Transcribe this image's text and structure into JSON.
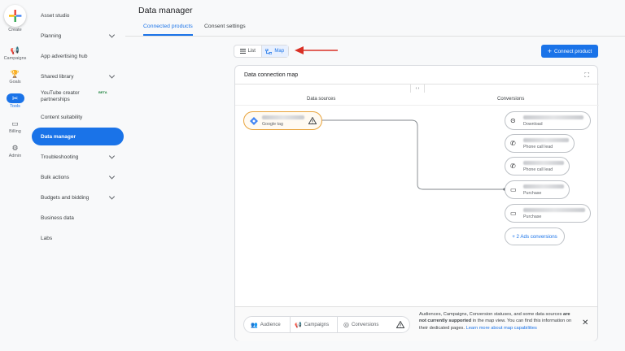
{
  "rail": {
    "create": "Create",
    "items": [
      {
        "label": "Campaigns",
        "icon": "megaphone-icon"
      },
      {
        "label": "Goals",
        "icon": "trophy-icon"
      },
      {
        "label": "Tools",
        "icon": "tools-icon"
      },
      {
        "label": "Billing",
        "icon": "credit-card-icon"
      },
      {
        "label": "Admin",
        "icon": "gear-icon"
      }
    ]
  },
  "sidebar": {
    "items": [
      {
        "label": "Asset studio",
        "chevron": false
      },
      {
        "label": "Planning",
        "chevron": true
      },
      {
        "label": "App advertising hub",
        "chevron": false
      },
      {
        "label": "Shared library",
        "chevron": true
      },
      {
        "label": "YouTube creator partnerships",
        "badge": "BETA",
        "chevron": false
      },
      {
        "label": "Content suitability",
        "chevron": false
      },
      {
        "label": "Data manager",
        "chevron": false,
        "active": true
      },
      {
        "label": "Troubleshooting",
        "chevron": true
      },
      {
        "label": "Bulk actions",
        "chevron": true
      },
      {
        "label": "Budgets and bidding",
        "chevron": true
      },
      {
        "label": "Business data",
        "chevron": false
      },
      {
        "label": "Labs",
        "chevron": false
      }
    ]
  },
  "header": {
    "title": "Data manager",
    "tabs": [
      {
        "label": "Connected products",
        "active": true
      },
      {
        "label": "Consent settings",
        "active": false
      }
    ]
  },
  "toolbar": {
    "list_label": "List",
    "map_label": "Map",
    "selected_view": "Map",
    "connect_label": "Connect product"
  },
  "map": {
    "title": "Data connection map",
    "expand_glyph": "‹ ›",
    "col_sources": "Data sources",
    "col_conversions": "Conversions",
    "source": {
      "subtitle": "Google tag",
      "warning": true
    },
    "conversions": [
      {
        "subtitle": "Download",
        "icon": "download-icon"
      },
      {
        "subtitle": "Phone call lead",
        "icon": "phone-icon"
      },
      {
        "subtitle": "Phone call lead",
        "icon": "phone-icon"
      },
      {
        "subtitle": "Purchase",
        "icon": "credit-card-icon",
        "connected": true
      },
      {
        "subtitle": "Purchase",
        "icon": "credit-card-icon"
      }
    ],
    "more_conversions": "+ 2 Ads conversions"
  },
  "bottom": {
    "chips": [
      "Audience",
      "Campaigns",
      "Conversions"
    ],
    "notice_pre": "Audiences, Campaigns, Conversion statuses, and some data sources ",
    "notice_bold": "are not currently supported",
    "notice_mid": " in the map view. You can find this information on their dedicated pages. ",
    "notice_link": "Learn more about map capabilities"
  },
  "colors": {
    "accent": "#1a73e8",
    "warning": "#e8a33b",
    "arrow": "#d93025"
  }
}
